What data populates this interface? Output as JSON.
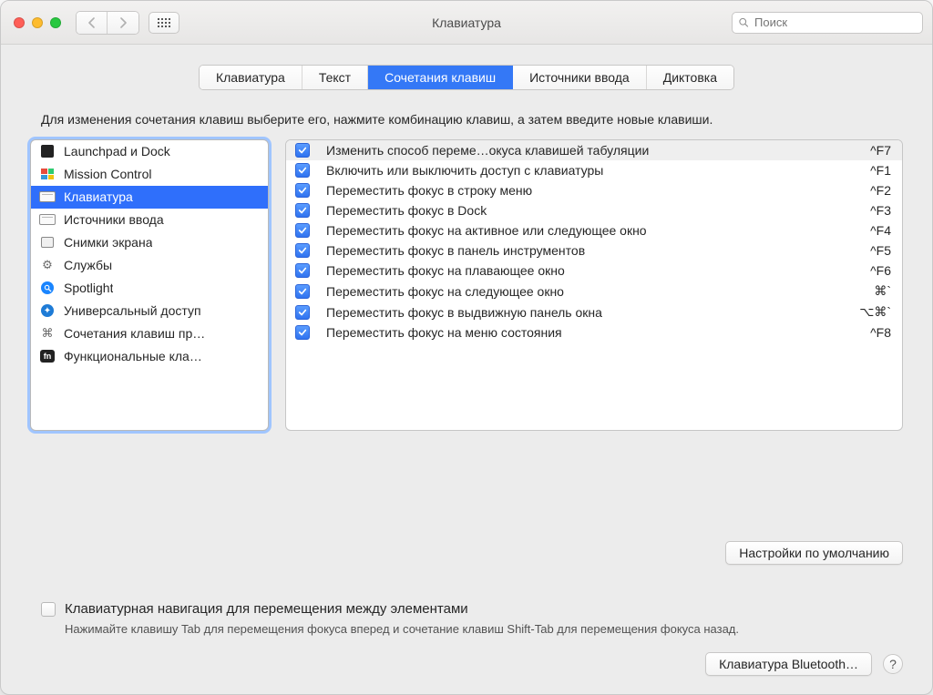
{
  "window": {
    "title": "Клавиатура"
  },
  "search": {
    "placeholder": "Поиск"
  },
  "tabs": [
    {
      "label": "Клавиатура",
      "active": false
    },
    {
      "label": "Текст",
      "active": false
    },
    {
      "label": "Сочетания клавиш",
      "active": true
    },
    {
      "label": "Источники ввода",
      "active": false
    },
    {
      "label": "Диктовка",
      "active": false
    }
  ],
  "instructions": "Для изменения сочетания клавиш выберите его, нажмите комбинацию клавиш, а затем введите новые клавиши.",
  "sidebar": [
    {
      "label": "Launchpad и Dock",
      "icon": "launchpad",
      "selected": false
    },
    {
      "label": "Mission Control",
      "icon": "mission",
      "selected": false
    },
    {
      "label": "Клавиатура",
      "icon": "keyboard",
      "selected": true
    },
    {
      "label": "Источники ввода",
      "icon": "keyboard2",
      "selected": false
    },
    {
      "label": "Снимки экрана",
      "icon": "screenshot",
      "selected": false
    },
    {
      "label": "Службы",
      "icon": "gear",
      "selected": false
    },
    {
      "label": "Spotlight",
      "icon": "spotlight",
      "selected": false
    },
    {
      "label": "Универсальный доступ",
      "icon": "accessibility",
      "selected": false
    },
    {
      "label": "Сочетания клавиш пр…",
      "icon": "command",
      "selected": false
    },
    {
      "label": "Функциональные кла…",
      "icon": "fn",
      "selected": false
    }
  ],
  "shortcuts": [
    {
      "checked": true,
      "label": "Изменить способ переме…окуса клавишей табуляции",
      "key": "^F7",
      "highlight": true
    },
    {
      "checked": true,
      "label": "Включить или выключить доступ с клавиатуры",
      "key": "^F1",
      "highlight": false
    },
    {
      "checked": true,
      "label": "Переместить фокус в строку меню",
      "key": "^F2",
      "highlight": false
    },
    {
      "checked": true,
      "label": "Переместить фокус в Dock",
      "key": "^F3",
      "highlight": false
    },
    {
      "checked": true,
      "label": "Переместить фокус на активное или следующее окно",
      "key": "^F4",
      "highlight": false
    },
    {
      "checked": true,
      "label": "Переместить фокус в панель инструментов",
      "key": "^F5",
      "highlight": false
    },
    {
      "checked": true,
      "label": "Переместить фокус на плавающее окно",
      "key": "^F6",
      "highlight": false
    },
    {
      "checked": true,
      "label": "Переместить фокус на следующее окно",
      "key": "⌘`",
      "highlight": false
    },
    {
      "checked": true,
      "label": "Переместить фокус в выдвижную панель окна",
      "key": "⌥⌘`",
      "highlight": false
    },
    {
      "checked": true,
      "label": "Переместить фокус на меню состояния",
      "key": "^F8",
      "highlight": false
    }
  ],
  "buttons": {
    "defaults": "Настройки по умолчанию",
    "bluetooth": "Клавиатура Bluetooth…"
  },
  "checkbox": {
    "label": "Клавиатурная навигация для перемещения между элементами",
    "sub": "Нажимайте клавишу Tab для перемещения фокуса вперед и сочетание клавиш Shift-Tab для перемещения фокуса назад."
  },
  "help": "?"
}
